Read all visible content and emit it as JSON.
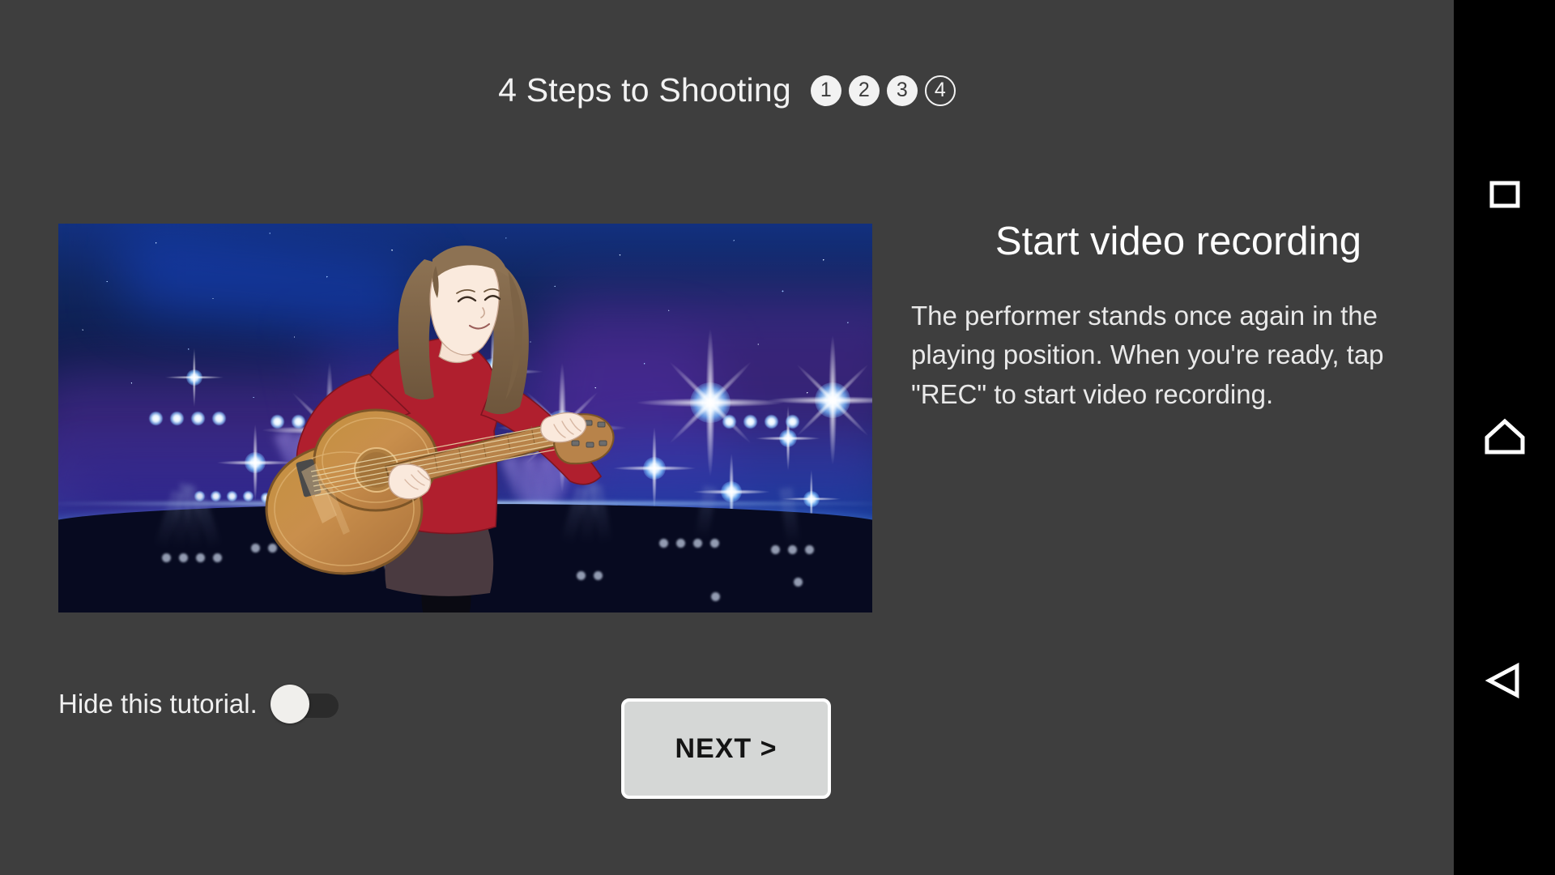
{
  "header": {
    "title": "4 Steps to Shooting",
    "steps": [
      {
        "label": "1",
        "state": "completed"
      },
      {
        "label": "2",
        "state": "completed"
      },
      {
        "label": "3",
        "state": "completed"
      },
      {
        "label": "4",
        "state": "current"
      }
    ]
  },
  "panel": {
    "title": "Start video recording",
    "body": "The performer stands once again in the playing position. When you're ready, tap \"REC\" to start video recording."
  },
  "illustration": {
    "alt": "Illustration of a woman in a red sweater playing an acoustic guitar on a dark blue starry stage lit by spotlights"
  },
  "footer": {
    "hide_tutorial_label": "Hide this tutorial.",
    "toggle_state": "off",
    "next_label": "NEXT >"
  },
  "navbar": {
    "recents": "recents-square",
    "home": "home-pentagon",
    "back": "back-triangle"
  },
  "colors": {
    "background": "#3e3e3e",
    "text_primary": "#ffffff",
    "text_body": "#e9e9e9",
    "button_fill": "#d5d7d6",
    "button_border": "#ffffff",
    "button_text": "#141414",
    "toggle_track": "#2b2b2b",
    "toggle_knob": "#f0efec",
    "navbar_background": "#000000",
    "navbar_icon": "#ffffff"
  }
}
